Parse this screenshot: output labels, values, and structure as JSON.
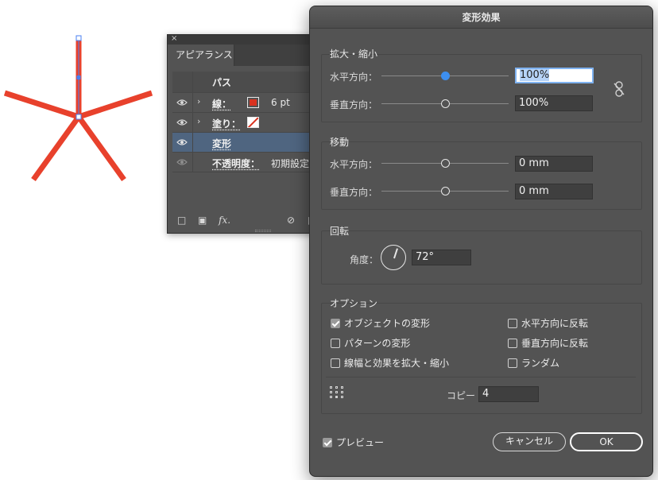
{
  "appearance_panel": {
    "tab": "アピアランス",
    "close_glyph": "×",
    "path_label": "パス",
    "rows": [
      {
        "label": "線：",
        "value": "6 pt",
        "swatch_color": "#d9321f"
      },
      {
        "label": "塗り：",
        "swatch_type": "none"
      },
      {
        "label": "変形"
      },
      {
        "label": "不透明度：",
        "value": "初期設定"
      }
    ],
    "fx_label": "fx.",
    "icons": [
      "eye-icon",
      "chevron-right-icon",
      "add-stroke-icon",
      "add-fill-icon",
      "fx-icon",
      "clear-icon"
    ]
  },
  "dialog": {
    "title": "変形効果",
    "scale": {
      "title": "拡大・縮小",
      "horizontal_label": "水平方向：",
      "horizontal_value": "100%",
      "vertical_label": "垂直方向：",
      "vertical_value": "100%"
    },
    "move": {
      "title": "移動",
      "horizontal_label": "水平方向：",
      "horizontal_value": "0 mm",
      "vertical_label": "垂直方向：",
      "vertical_value": "0 mm"
    },
    "rotate": {
      "title": "回転",
      "angle_label": "角度：",
      "angle_value": "72°"
    },
    "options": {
      "title": "オプション",
      "transform_objects": {
        "label": "オブジェクトの変形",
        "checked": true
      },
      "transform_patterns": {
        "label": "パターンの変形",
        "checked": false
      },
      "scale_strokes": {
        "label": "線幅と効果を拡大・縮小",
        "checked": false
      },
      "reflect_x": {
        "label": "水平方向に反転",
        "checked": false
      },
      "reflect_y": {
        "label": "垂直方向に反転",
        "checked": false
      },
      "random": {
        "label": "ランダム",
        "checked": false
      },
      "copies_label": "コピー",
      "copies_value": "4"
    },
    "preview": {
      "label": "プレビュー",
      "checked": true
    },
    "cancel_label": "キャンセル",
    "ok_label": "OK"
  },
  "colors": {
    "artwork_stroke": "#e8412c",
    "selection": "#4a7ff0",
    "accent": "#3d8ff0"
  }
}
